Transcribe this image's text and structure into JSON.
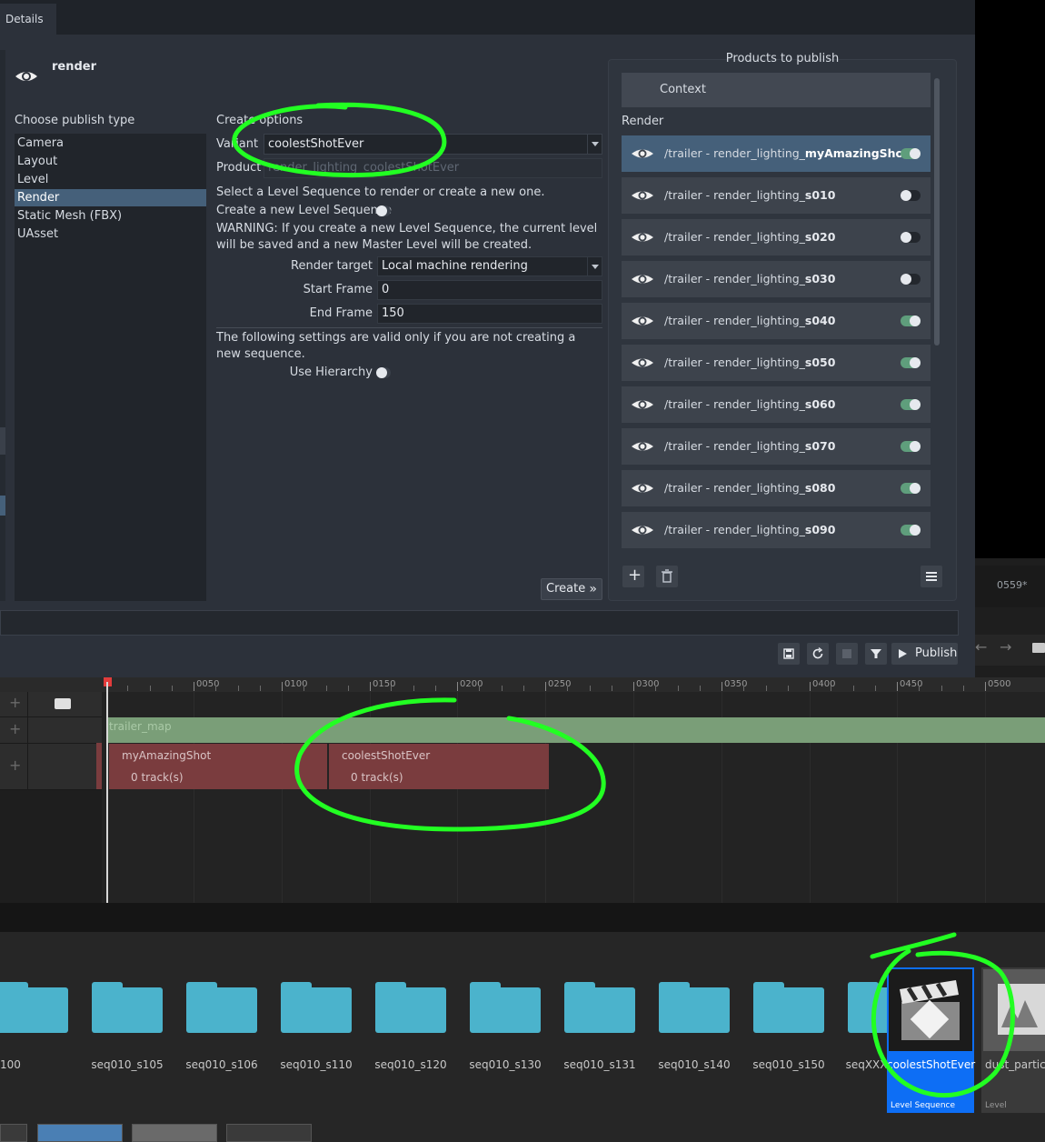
{
  "tab": {
    "label": "Details"
  },
  "family": {
    "title": "render"
  },
  "chooser": {
    "label": "Choose publish type",
    "items": [
      "Camera",
      "Layout",
      "Level",
      "Render",
      "Static Mesh (FBX)",
      "UAsset"
    ],
    "selected": "Render"
  },
  "options": {
    "header": "Create options",
    "variant_label": "Variant",
    "variant_value": "coolestShotEver",
    "product_label": "Product",
    "product_value": "render_lighting_coolestShotEver",
    "info_text": "Select a Level Sequence to render or create a new one.",
    "create_new_label": "Create a new Level Sequence",
    "create_new_on": false,
    "warning_text": "WARNING: If you create a new Level Sequence, the current level will be saved and a new Master Level will be created.",
    "render_target_label": "Render target",
    "render_target_value": "Local machine rendering",
    "start_frame_label": "Start Frame",
    "start_frame_value": "0",
    "end_frame_label": "End Frame",
    "end_frame_value": "150",
    "note_text": "The following settings are valid only if you are not creating a new sequence.",
    "hierarchy_label": "Use Hierarchy",
    "hierarchy_on": false,
    "create_button": "Create"
  },
  "products": {
    "title": "Products to publish",
    "context_label": "Context",
    "group_label": "Render",
    "items": [
      {
        "prefix": "/trailer - render_lighting_",
        "suffix": "myAmazingShot",
        "enabled": true,
        "selected": true
      },
      {
        "prefix": "/trailer - render_lighting_",
        "suffix": "s010",
        "enabled": false
      },
      {
        "prefix": "/trailer - render_lighting_",
        "suffix": "s020",
        "enabled": false
      },
      {
        "prefix": "/trailer - render_lighting_",
        "suffix": "s030",
        "enabled": false
      },
      {
        "prefix": "/trailer - render_lighting_",
        "suffix": "s040",
        "enabled": true
      },
      {
        "prefix": "/trailer - render_lighting_",
        "suffix": "s050",
        "enabled": true
      },
      {
        "prefix": "/trailer - render_lighting_",
        "suffix": "s060",
        "enabled": true
      },
      {
        "prefix": "/trailer - render_lighting_",
        "suffix": "s070",
        "enabled": true
      },
      {
        "prefix": "/trailer - render_lighting_",
        "suffix": "s080",
        "enabled": true
      },
      {
        "prefix": "/trailer - render_lighting_",
        "suffix": "s090",
        "enabled": true
      }
    ]
  },
  "footer": {
    "publish_label": "Publish"
  },
  "viewport": {
    "frame_counter": "0559*"
  },
  "sequencer": {
    "ticks": [
      "0050",
      "0100",
      "0150",
      "0200",
      "0250",
      "0300",
      "0350",
      "0400",
      "0450",
      "0500"
    ],
    "level_track": "trailer_map",
    "shots": [
      {
        "name": "myAmazingShot",
        "tracks": "0 track(s)"
      },
      {
        "name": "coolestShotEver",
        "tracks": "0 track(s)"
      }
    ]
  },
  "browser": {
    "folders": [
      "100",
      "seq010_s105",
      "seq010_s106",
      "seq010_s110",
      "seq010_s120",
      "seq010_s130",
      "seq010_s131",
      "seq010_s140",
      "seq010_s150",
      "seqXXX_sXXX"
    ],
    "selected_asset": {
      "name": "coolestShotEver",
      "type": "Level Sequence"
    },
    "other_asset": {
      "name": "dust_particle",
      "type": "Level"
    }
  },
  "colors": {
    "accent": "#45607a",
    "toggle_on": "#5f9e7c",
    "folder": "#4bb3cc",
    "selection": "#0d6ef5",
    "annotation": "#22ff22"
  }
}
